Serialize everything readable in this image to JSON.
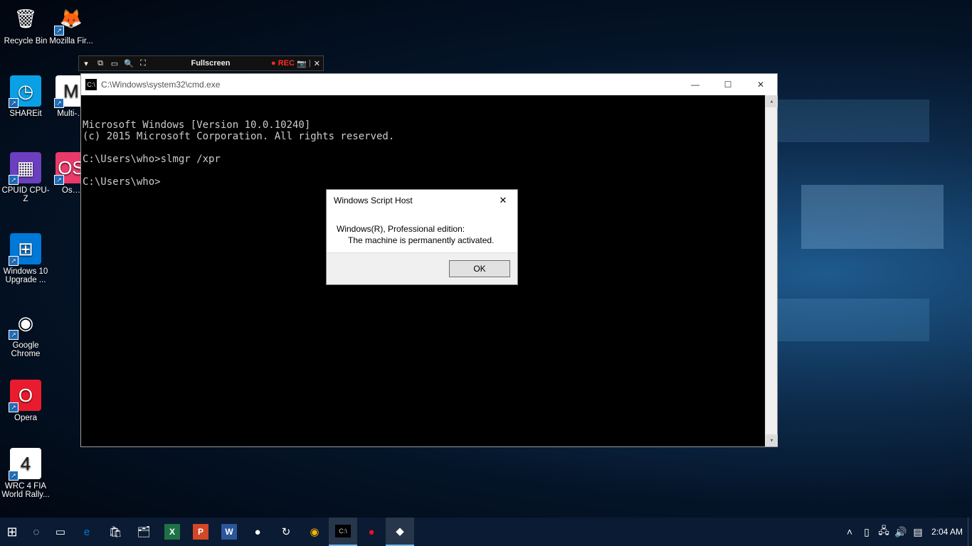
{
  "desktop_icons": [
    {
      "id": "recycle-bin",
      "label": "Recycle Bin",
      "glyph": "🗑",
      "bg": "transparent",
      "col": 0,
      "row": 0,
      "shortcut": false
    },
    {
      "id": "firefox",
      "label": "Mozilla Fir...",
      "glyph": "🦊",
      "bg": "transparent",
      "col": 1,
      "row": 0,
      "shortcut": true
    },
    {
      "id": "shareit",
      "label": "SHAREit",
      "glyph": "◷",
      "bg": "#0aa0e6",
      "col": 0,
      "row": 1,
      "shortcut": true
    },
    {
      "id": "multi",
      "label": "Multi-…",
      "glyph": "M",
      "bg": "#fff",
      "col": 1,
      "row": 1,
      "shortcut": true
    },
    {
      "id": "cpuz",
      "label": "CPUID CPU-Z",
      "glyph": "▦",
      "bg": "#6b3fbf",
      "col": 0,
      "row": 2,
      "shortcut": true
    },
    {
      "id": "os",
      "label": "Os…",
      "glyph": "OS",
      "bg": "#ea3a6a",
      "col": 1,
      "row": 2,
      "shortcut": true
    },
    {
      "id": "win10up",
      "label": "Windows 10 Upgrade ...",
      "glyph": "⊞",
      "bg": "#0078d7",
      "col": 0,
      "row": 3,
      "shortcut": true
    },
    {
      "id": "chrome",
      "label": "Google Chrome",
      "glyph": "◉",
      "bg": "transparent",
      "col": 0,
      "row": 4,
      "shortcut": true
    },
    {
      "id": "opera",
      "label": "Opera",
      "glyph": "O",
      "bg": "#e81c2e",
      "col": 0,
      "row": 5,
      "shortcut": true
    },
    {
      "id": "wrc4",
      "label": "WRC 4 FIA World Rally...",
      "glyph": "4",
      "bg": "#fff",
      "col": 0,
      "row": 6,
      "shortcut": true
    }
  ],
  "recorder": {
    "title": "Fullscreen",
    "rec_label": "REC"
  },
  "cmd": {
    "title": "C:\\Windows\\system32\\cmd.exe",
    "lines": [
      "Microsoft Windows [Version 10.0.10240]",
      "(c) 2015 Microsoft Corporation. All rights reserved.",
      "",
      "C:\\Users\\who>slmgr /xpr",
      "",
      "C:\\Users\\who>"
    ]
  },
  "dialog": {
    "title": "Windows Script Host",
    "line1": "Windows(R), Professional edition:",
    "line2": "The machine is permanently activated.",
    "ok": "OK"
  },
  "taskbar": {
    "apps": [
      {
        "id": "start",
        "glyph": "⊞"
      },
      {
        "id": "search",
        "glyph": "◌"
      },
      {
        "id": "taskview",
        "glyph": "▭"
      },
      {
        "id": "edge",
        "glyph": "e"
      },
      {
        "id": "store",
        "glyph": "🛍"
      },
      {
        "id": "explorer",
        "glyph": "🗂"
      },
      {
        "id": "excel",
        "glyph": "X"
      },
      {
        "id": "powerpoint",
        "glyph": "P"
      },
      {
        "id": "word",
        "glyph": "W"
      },
      {
        "id": "app1",
        "glyph": "●"
      },
      {
        "id": "app2",
        "glyph": "↻"
      },
      {
        "id": "chrome",
        "glyph": "◉"
      },
      {
        "id": "cmd",
        "glyph": "▪",
        "active": true
      },
      {
        "id": "rec",
        "glyph": "●"
      },
      {
        "id": "app3",
        "glyph": "◆",
        "active": true
      }
    ],
    "clock": "2:04 AM"
  }
}
